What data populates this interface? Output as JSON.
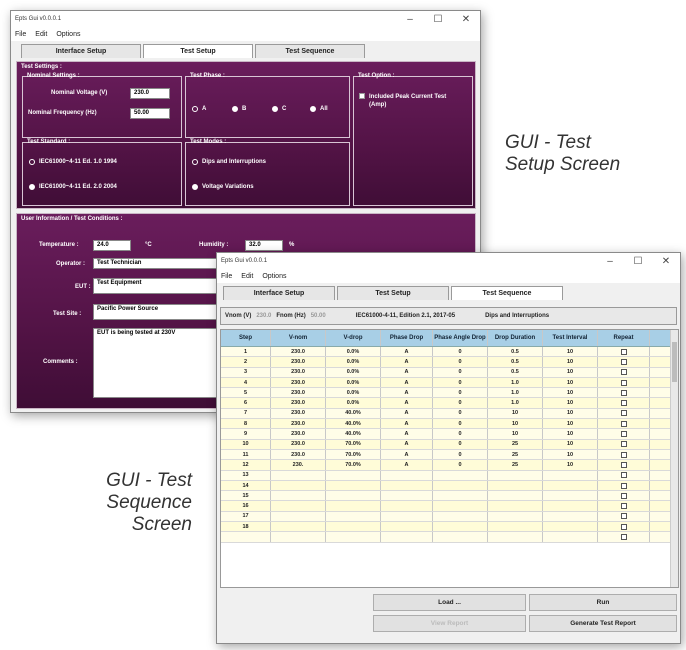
{
  "setup_window": {
    "title": "Epts Gui v0.0.0.1",
    "menu": [
      "File",
      "Edit",
      "Options"
    ],
    "tabs": [
      "Interface Setup",
      "Test Setup",
      "Test Sequence"
    ],
    "test_settings_label": "Test Settings :",
    "nominal_settings": {
      "label": "Nominal Settings :",
      "voltage_label": "Nominal Voltage (V)",
      "voltage_value": "230.0",
      "frequency_label": "Nominal Frequency (Hz)",
      "frequency_value": "50.00"
    },
    "test_phase": {
      "label": "Test Phase :",
      "options": [
        "A",
        "B",
        "C",
        "All"
      ]
    },
    "test_option": {
      "label": "Test Option :",
      "checkbox_label": "Included Peak Current Test (Amp)"
    },
    "test_standard": {
      "label": "Test Standard :",
      "options": [
        "IEC61000~4-11 Ed. 1.0 1994",
        "IEC61000~4-11 Ed. 2.0 2004"
      ]
    },
    "test_modes": {
      "label": "Test Modes :",
      "options": [
        "Dips and Interruptions",
        "Voltage Variations"
      ]
    },
    "user_info": {
      "label": "User Information / Test Conditions :",
      "temperature_label": "Temperature :",
      "temperature_value": "24.0",
      "temperature_unit": "°C",
      "humidity_label": "Humidity :",
      "humidity_value": "32.0",
      "humidity_unit": "%",
      "operator_label": "Operator :",
      "operator_value": "Test Technician",
      "eut_label": "EUT :",
      "eut_value": "Test Equipment",
      "test_site_label": "Test Site :",
      "test_site_value": "Pacific Power Source",
      "comments_label": "Comments :",
      "comments_value": "EUT is being tested at 230V"
    }
  },
  "sequence_window": {
    "title": "Epts Gui v0.0.0.1",
    "menu": [
      "File",
      "Edit",
      "Options"
    ],
    "tabs": [
      "Interface Setup",
      "Test Setup",
      "Test Sequence"
    ],
    "info": {
      "vnom_label": "Vnom (V)",
      "vnom_value": "230.0",
      "fnom_label": "Fnom (Hz)",
      "fnom_value": "50.00",
      "standard": "IEC61000-4-11, Edition 2.1, 2017-05",
      "mode": "Dips and Interruptions"
    },
    "columns": [
      "Step",
      "V-nom",
      "V-drop",
      "Phase Drop",
      "Phase Angle Drop",
      "Drop Duration",
      "Test Interval",
      "Repeat"
    ],
    "rows": [
      [
        "1",
        "230.0",
        "0.0%",
        "A",
        "0",
        "0.5",
        "10"
      ],
      [
        "2",
        "230.0",
        "0.0%",
        "A",
        "0",
        "0.5",
        "10"
      ],
      [
        "3",
        "230.0",
        "0.0%",
        "A",
        "0",
        "0.5",
        "10"
      ],
      [
        "4",
        "230.0",
        "0.0%",
        "A",
        "0",
        "1.0",
        "10"
      ],
      [
        "5",
        "230.0",
        "0.0%",
        "A",
        "0",
        "1.0",
        "10"
      ],
      [
        "6",
        "230.0",
        "0.0%",
        "A",
        "0",
        "1.0",
        "10"
      ],
      [
        "7",
        "230.0",
        "40.0%",
        "A",
        "0",
        "10",
        "10"
      ],
      [
        "8",
        "230.0",
        "40.0%",
        "A",
        "0",
        "10",
        "10"
      ],
      [
        "9",
        "230.0",
        "40.0%",
        "A",
        "0",
        "10",
        "10"
      ],
      [
        "10",
        "230.0",
        "70.0%",
        "A",
        "0",
        "25",
        "10"
      ],
      [
        "11",
        "230.0",
        "70.0%",
        "A",
        "0",
        "25",
        "10"
      ],
      [
        "12",
        "230.",
        "70.0%",
        "A",
        "0",
        "25",
        "10"
      ],
      [
        "13",
        "",
        "",
        "",
        "",
        "",
        ""
      ],
      [
        "14",
        "",
        "",
        "",
        "",
        "",
        ""
      ],
      [
        "15",
        "",
        "",
        "",
        "",
        "",
        ""
      ],
      [
        "16",
        "",
        "",
        "",
        "",
        "",
        ""
      ],
      [
        "17",
        "",
        "",
        "",
        "",
        "",
        ""
      ],
      [
        "18",
        "",
        "",
        "",
        "",
        "",
        ""
      ],
      [
        "",
        "",
        "",
        "",
        "",
        "",
        ""
      ]
    ],
    "buttons": {
      "load": "Load ...",
      "run": "Run",
      "view_report": "View Report",
      "generate_report": "Generate Test Report"
    }
  },
  "captions": {
    "setup_line1": "GUI - Test",
    "setup_line2": "Setup Screen",
    "sequence_line1": "GUI - Test",
    "sequence_line2": "Sequence",
    "sequence_line3": "Screen"
  },
  "colors": {
    "panel_purple": "#5a164d",
    "table_header": "#a8cfe6",
    "table_row": "#fffde8"
  }
}
